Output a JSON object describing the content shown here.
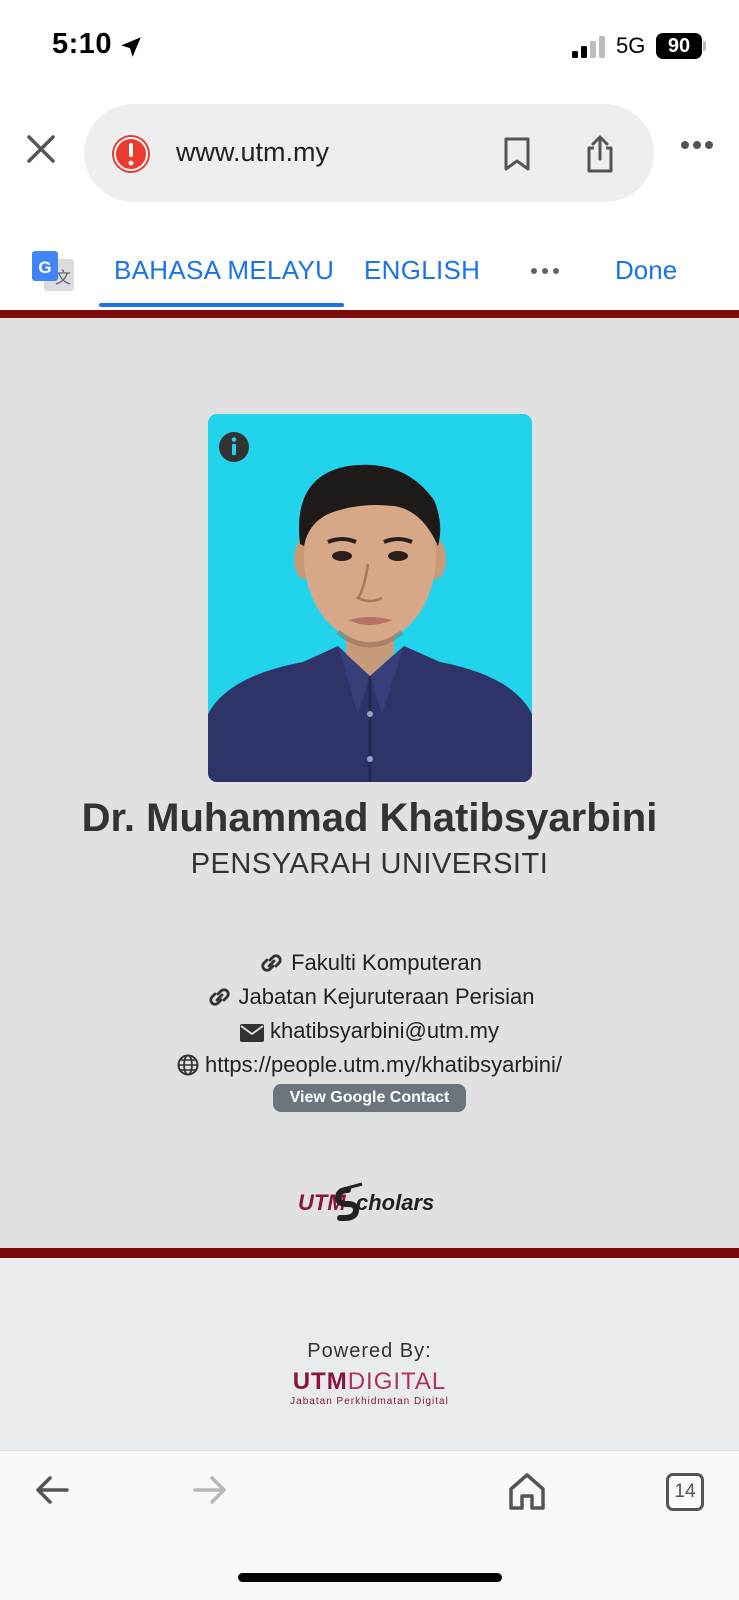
{
  "status_bar": {
    "time": "5:10",
    "network": "5G",
    "battery": "90"
  },
  "address_bar": {
    "url": "www.utm.my",
    "icons": [
      "close-icon",
      "warning-icon",
      "bookmark-icon",
      "share-icon",
      "more-icon"
    ]
  },
  "translate_bar": {
    "tab_malay": "BAHASA MELAYU",
    "tab_english": "ENGLISH",
    "done": "Done",
    "active_tab": "BAHASA MELAYU"
  },
  "profile": {
    "name": "Dr. Muhammad Khatibsyarbini",
    "title": "PENSYARAH UNIVERSITI",
    "faculty": "Fakulti Komputeran",
    "department": "Jabatan Kejuruteraan Perisian",
    "email": "khatibsyarbini@utm.my",
    "website": "https://people.utm.my/khatibsyarbini/",
    "contact_button": "View Google Contact",
    "logo_text_utm": "UTM",
    "logo_text_scholars": "cholars"
  },
  "footer": {
    "powered_by": "Powered By:",
    "brand_strong": "UTM",
    "brand_light": "DIGITAL",
    "brand_sub": "Jabatan Perkhidmatan Digital"
  },
  "toolbar": {
    "tab_count": "14"
  },
  "colors": {
    "accent_blue": "#1a73e8",
    "utm_maroon": "#7c0a0a",
    "photo_background": "#20d4ec"
  }
}
